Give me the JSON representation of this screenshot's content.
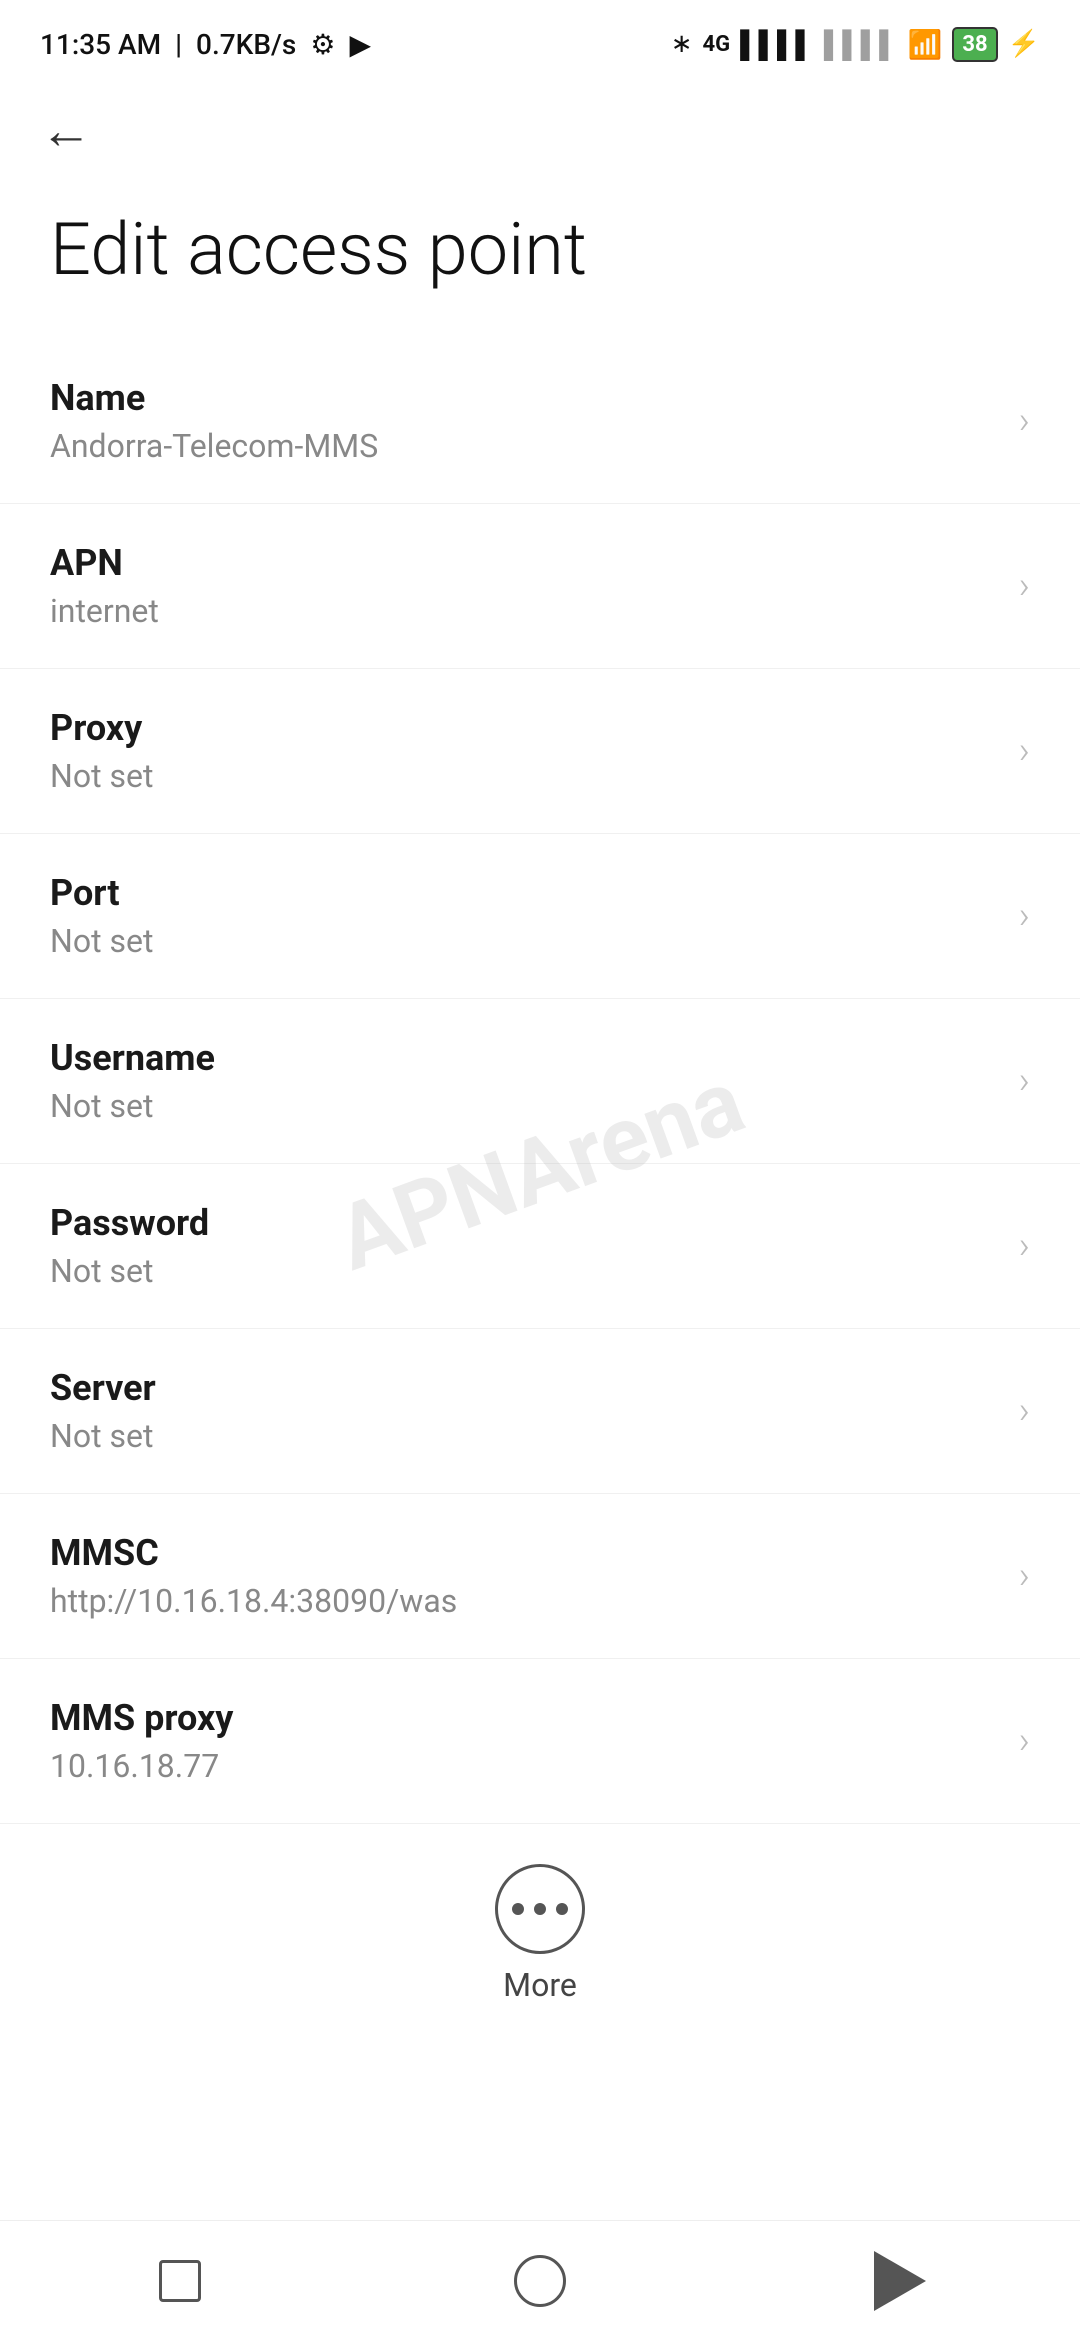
{
  "statusBar": {
    "time": "11:35 AM",
    "speed": "0.7KB/s"
  },
  "page": {
    "title": "Edit access point",
    "backArrow": "←"
  },
  "settings": [
    {
      "label": "Name",
      "value": "Andorra-Telecom-MMS"
    },
    {
      "label": "APN",
      "value": "internet"
    },
    {
      "label": "Proxy",
      "value": "Not set"
    },
    {
      "label": "Port",
      "value": "Not set"
    },
    {
      "label": "Username",
      "value": "Not set"
    },
    {
      "label": "Password",
      "value": "Not set"
    },
    {
      "label": "Server",
      "value": "Not set"
    },
    {
      "label": "MMSC",
      "value": "http://10.16.18.4:38090/was"
    },
    {
      "label": "MMS proxy",
      "value": "10.16.18.77"
    }
  ],
  "more": {
    "label": "More"
  },
  "watermark": "APNArena"
}
